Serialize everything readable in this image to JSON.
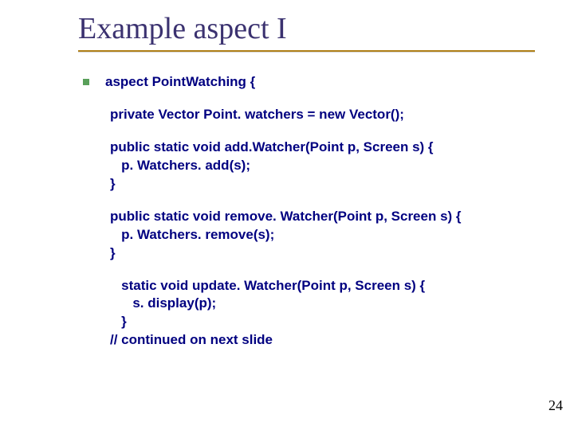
{
  "title": "Example aspect I",
  "bullet": "aspect PointWatching {",
  "para1": "private Vector Point. watchers = new Vector();",
  "para2": "public static void add.Watcher(Point p, Screen s) {\n   p. Watchers. add(s);\n}",
  "para3": "public static void remove. Watcher(Point p, Screen s) {\n   p. Watchers. remove(s);\n}",
  "para4": "   static void update. Watcher(Point p, Screen s) {\n      s. display(p);\n   }\n// continued on next slide",
  "pagenum": "24"
}
